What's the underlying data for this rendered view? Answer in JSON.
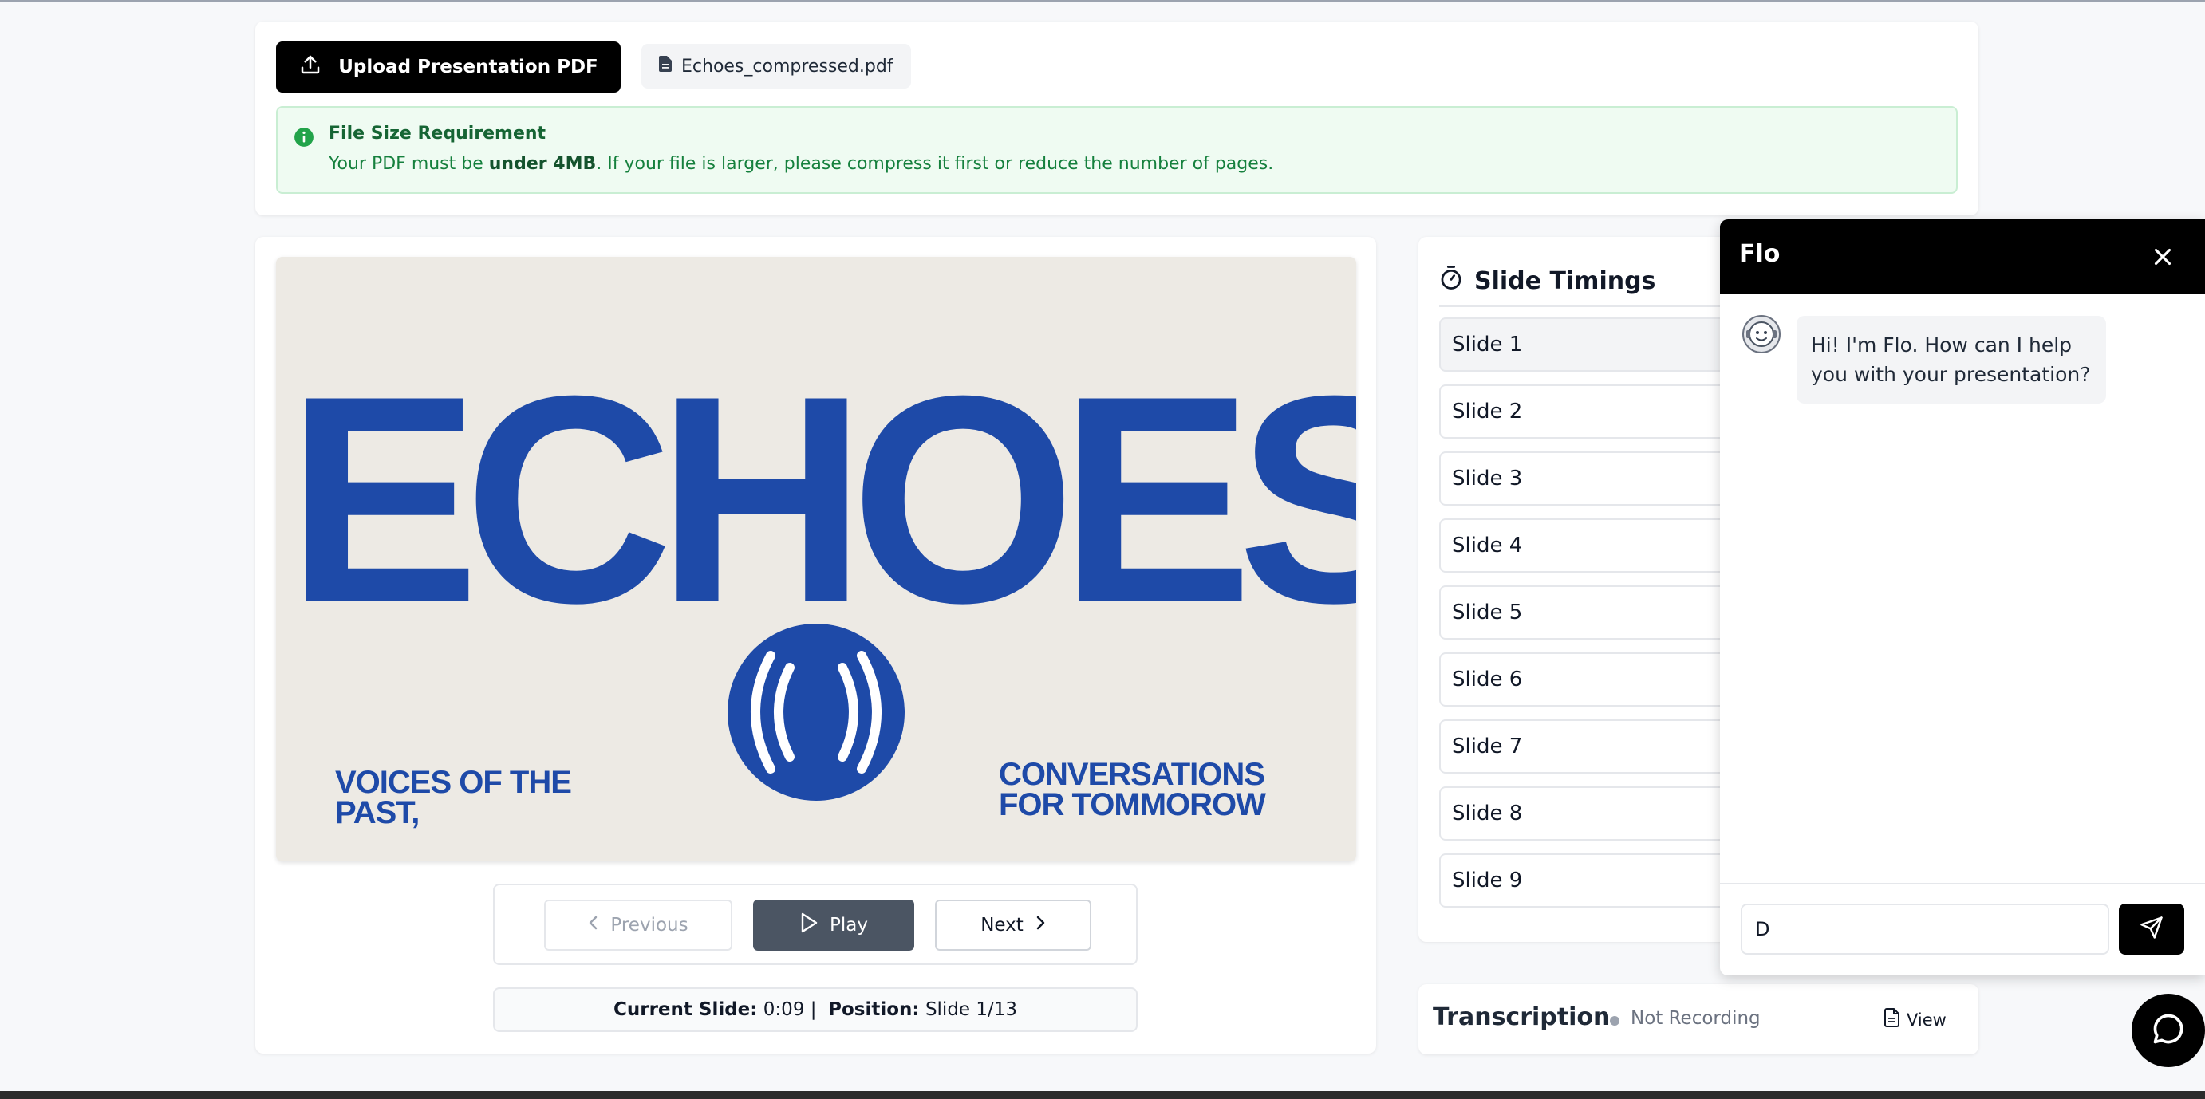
{
  "colors": {
    "primary": "#000000",
    "slide_blue": "#1e4aa8",
    "notice_bg": "#effbf2",
    "notice_text": "#15803d"
  },
  "upload": {
    "button_label": "Upload Presentation PDF",
    "button_icon": "upload-icon",
    "file_name": "Echoes_compressed.pdf",
    "file_icon": "document-icon"
  },
  "notice": {
    "icon": "info-icon",
    "title": "File Size Requirement",
    "text_before": "Your PDF must be ",
    "text_bold": "under 4MB",
    "text_after": ". If your file is larger, please compress it first or reduce the number of pages."
  },
  "slide": {
    "title": "ECHOES",
    "left_text": "VOICES OF THE PAST,",
    "right_text": "CONVERSATIONS FOR TOMMOROW",
    "logo_icon": "broadcast-icon"
  },
  "controls": {
    "previous_label": "Previous",
    "play_label": "Play",
    "next_label": "Next"
  },
  "status": {
    "current_slide_label": "Current Slide:",
    "current_slide_time": "0:09",
    "separator": "|",
    "position_label": "Position:",
    "position_value": "Slide 1/13"
  },
  "timings": {
    "title": "Slide Timings",
    "icon": "stopwatch-icon",
    "slides": [
      "Slide 1",
      "Slide 2",
      "Slide 3",
      "Slide 4",
      "Slide 5",
      "Slide 6",
      "Slide 7",
      "Slide 8",
      "Slide 9"
    ],
    "active_index": 0
  },
  "transcription": {
    "title": "Transcription",
    "status": "Not Recording",
    "view_label": "View",
    "view_icon": "document-icon"
  },
  "chat": {
    "title": "Flo",
    "close_icon": "close-icon",
    "avatar_icon": "bot-avatar-icon",
    "message": "Hi! I'm Flo. How can I help you with your presentation?",
    "input_value": "D",
    "send_icon": "send-icon",
    "fab_icon": "chat-bubble-icon"
  }
}
